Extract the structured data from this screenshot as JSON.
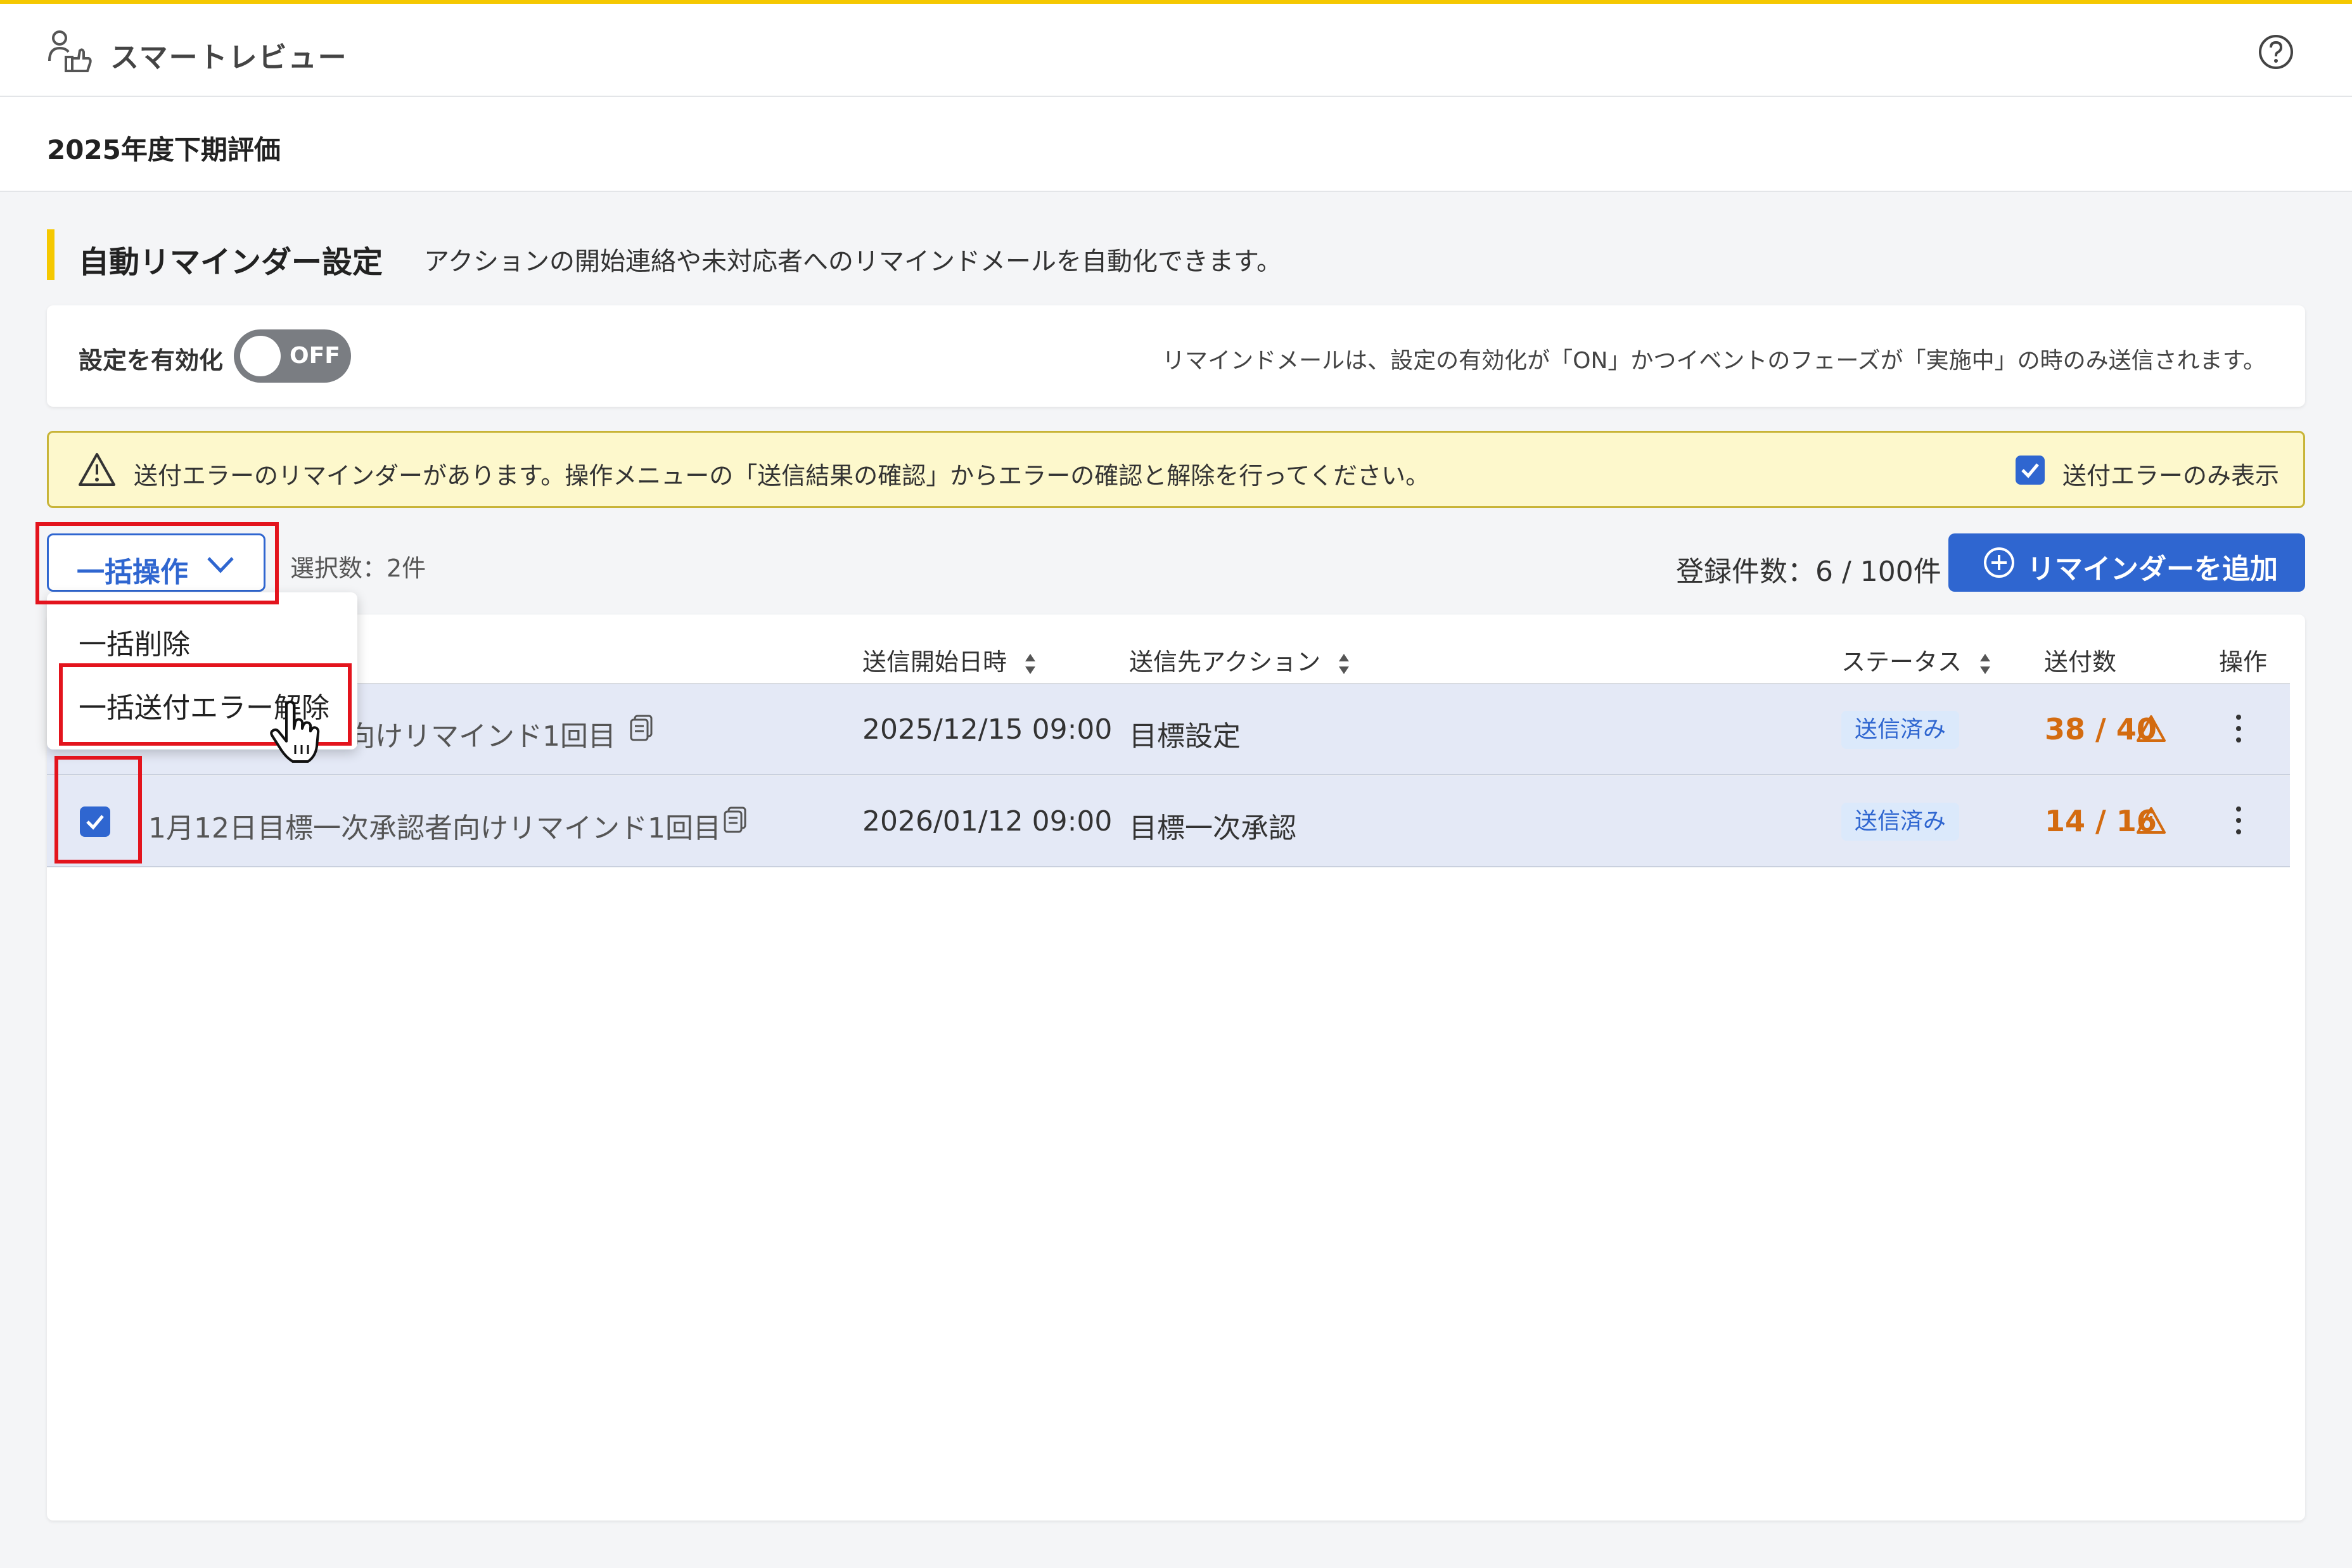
{
  "header": {
    "app_name": "スマートレビュー",
    "icons": [
      "reviewers-icon",
      "help-icon"
    ]
  },
  "page": {
    "title": "2025年度下期評価"
  },
  "section": {
    "title": "自動リマインダー設定",
    "description": "アクションの開始連絡や未対応者へのリマインドメールを自動化できます。"
  },
  "settings": {
    "enable_label": "設定を有効化",
    "toggle_state": "OFF",
    "note": "リマインドメールは、設定の有効化が「ON」かつイベントのフェーズが「実施中」の時のみ送信されます。"
  },
  "alert": {
    "text": "送付エラーのリマインダーがあります。操作メニューの「送信結果の確認」からエラーの確認と解除を行ってください。",
    "checkbox_label": "送付エラーのみ表示",
    "checkbox_checked": true
  },
  "toolbar": {
    "bulk_label": "一括操作",
    "selection_count": "選択数：2件",
    "registered_count": "登録件数：6 / 100件",
    "add_label": "リマインダーを追加"
  },
  "dropdown": {
    "items": [
      "一括削除",
      "一括送付エラー解除"
    ]
  },
  "table": {
    "headers": {
      "start": "送信開始日時",
      "action": "送信先アクション",
      "status": "ステータス",
      "sent": "送付数",
      "ops": "操作"
    },
    "rows": [
      {
        "name": "向けリマインド1回目",
        "start": "2025/12/15 09:00",
        "action": "目標設定",
        "status": "送信済み",
        "sent": "38 / 40",
        "checked": true
      },
      {
        "name": "1月12日目標一次承認者向けリマインド1回目",
        "start": "2026/01/12 09:00",
        "action": "目標一次承認",
        "status": "送信済み",
        "sent": "14 / 16",
        "checked": true
      }
    ]
  },
  "colors": {
    "accent": "#2f66d0",
    "brand_yellow": "#f5c800",
    "warning_orange": "#d36b10",
    "highlight_red": "#e3141d",
    "row_selected": "#e4e9f6"
  }
}
